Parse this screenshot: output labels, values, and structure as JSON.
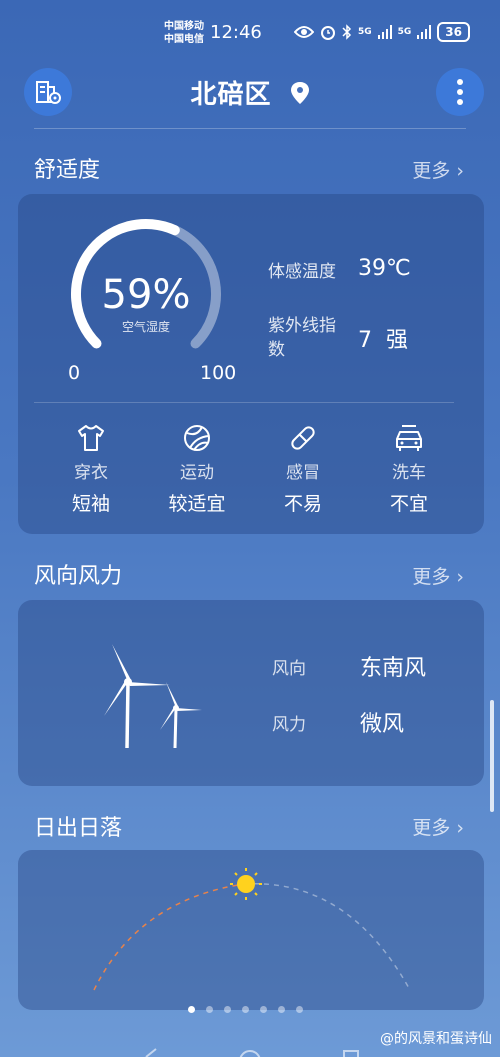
{
  "status_bar": {
    "carrier_1": "中国移动",
    "carrier_2": "中国电信",
    "time": "12:46",
    "signal_1": "5G",
    "signal_2": "5G",
    "battery": "36"
  },
  "header": {
    "location": "北碚区",
    "city_manage_icon": "building-gear-icon",
    "location_icon": "location-pin-icon",
    "more_icon": "vertical-dots-icon"
  },
  "comfort": {
    "title": "舒适度",
    "more": "更多",
    "humidity_value": "59%",
    "humidity_fraction": 0.59,
    "humidity_label": "空气湿度",
    "gauge_min": "0",
    "gauge_max": "100",
    "feels_like_label": "体感温度",
    "feels_like_value": "39℃",
    "uv_label_line1": "紫外线指",
    "uv_label_line2": "数",
    "uv_value": "7  强",
    "tips": [
      {
        "label": "穿衣",
        "value": "短袖",
        "icon": "tshirt-icon"
      },
      {
        "label": "运动",
        "value": "较适宜",
        "icon": "ball-icon"
      },
      {
        "label": "感冒",
        "value": "不易",
        "icon": "pill-icon"
      },
      {
        "label": "洗车",
        "value": "不宜",
        "icon": "car-wash-icon"
      }
    ]
  },
  "wind": {
    "title": "风向风力",
    "more": "更多",
    "direction_label": "风向",
    "direction_value": "东南风",
    "force_label": "风力",
    "force_value": "微风"
  },
  "sun": {
    "title": "日出日落",
    "more": "更多"
  },
  "pager": {
    "count": 7,
    "active": 0
  },
  "watermark": "@的风景和蛋诗仙",
  "colors": {
    "accent_button": "#3d79d9",
    "sun": "#ffd21e",
    "sunrise_path": "#e8834a"
  }
}
